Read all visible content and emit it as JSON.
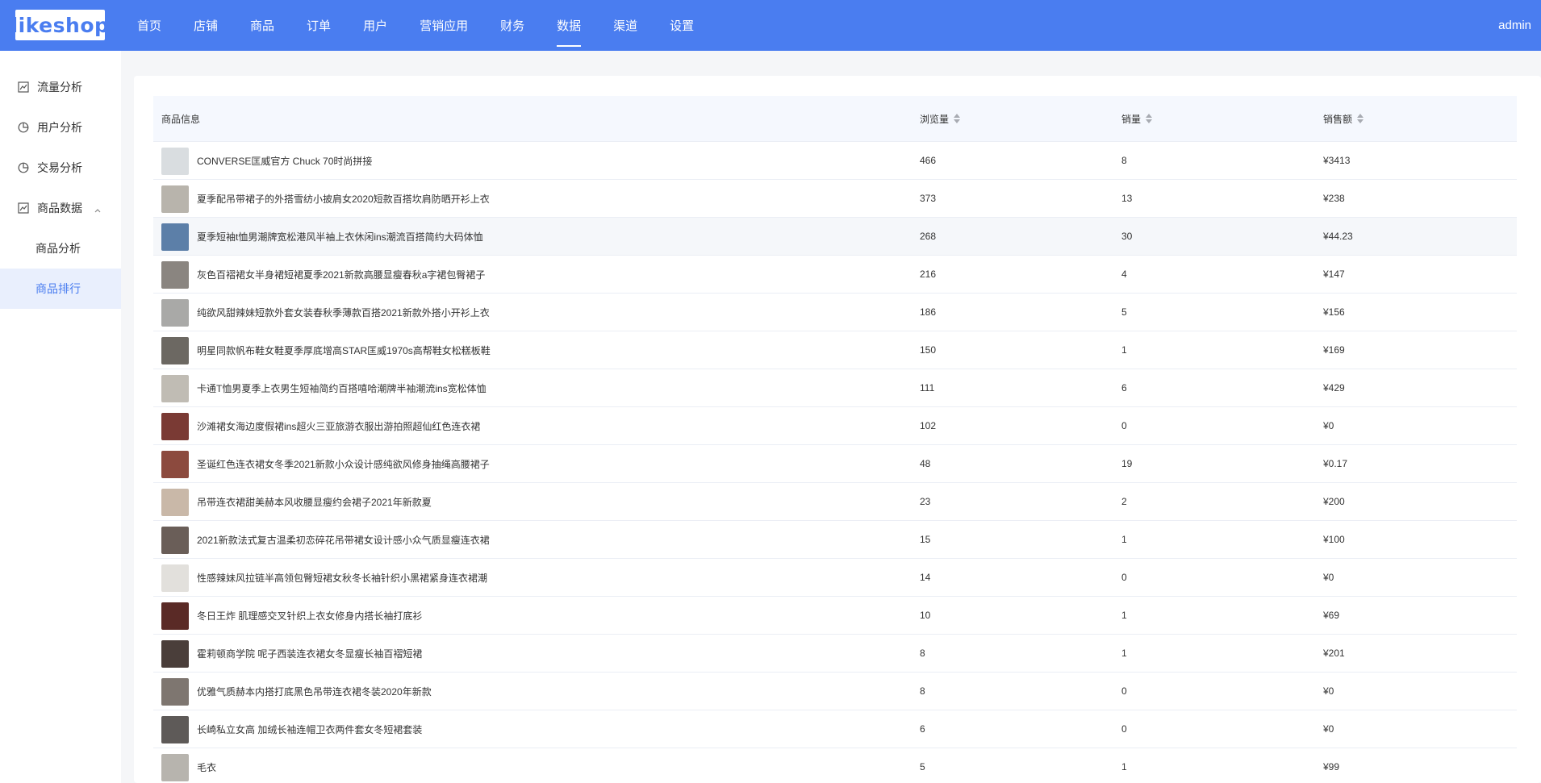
{
  "brand": {
    "logo_text": "likeshop"
  },
  "nav": {
    "items": [
      {
        "label": "首页"
      },
      {
        "label": "店铺"
      },
      {
        "label": "商品"
      },
      {
        "label": "订单"
      },
      {
        "label": "用户"
      },
      {
        "label": "营销应用"
      },
      {
        "label": "财务"
      },
      {
        "label": "数据",
        "active": true
      },
      {
        "label": "渠道"
      },
      {
        "label": "设置"
      }
    ],
    "user": "admin"
  },
  "sidebar": {
    "items": [
      {
        "label": "流量分析",
        "icon": "line-chart-icon"
      },
      {
        "label": "用户分析",
        "icon": "pie-chart-icon"
      },
      {
        "label": "交易分析",
        "icon": "pie-chart-icon"
      },
      {
        "label": "商品数据",
        "icon": "line-chart-icon"
      }
    ],
    "sub_items": [
      {
        "label": "商品分析"
      },
      {
        "label": "商品排行",
        "active": true
      }
    ]
  },
  "table": {
    "columns": {
      "info": "商品信息",
      "views": "浏览量",
      "sales": "销量",
      "amount": "销售额"
    },
    "rows": [
      {
        "name": "CONVERSE匡威官方 Chuck 70时尚拼接",
        "views": "466",
        "sales": "8",
        "amount": "¥3413",
        "thumb": "#d9dde0"
      },
      {
        "name": "夏季配吊带裙子的外搭雪纺小披肩女2020短款百搭坎肩防晒开衫上衣",
        "views": "373",
        "sales": "13",
        "amount": "¥238",
        "thumb": "#b8b4ac"
      },
      {
        "name": "夏季短袖t恤男潮牌宽松港风半袖上衣休闲ins潮流百搭简约大码体恤",
        "views": "268",
        "sales": "30",
        "amount": "¥44.23",
        "thumb": "#5c7fa8"
      },
      {
        "name": "灰色百褶裙女半身裙短裙夏季2021新款高腰显瘦春秋a字裙包臀裙子",
        "views": "216",
        "sales": "4",
        "amount": "¥147",
        "thumb": "#8a8580"
      },
      {
        "name": "纯欲风甜辣妹短款外套女装春秋季薄款百搭2021新款外搭小开衫上衣",
        "views": "186",
        "sales": "5",
        "amount": "¥156",
        "thumb": "#a9a9a7"
      },
      {
        "name": "明星同款帆布鞋女鞋夏季厚底增高STAR匡威1970s高帮鞋女松糕板鞋",
        "views": "150",
        "sales": "1",
        "amount": "¥169",
        "thumb": "#6c6862"
      },
      {
        "name": "卡通T恤男夏季上衣男生短袖简约百搭嘻哈潮牌半袖潮流ins宽松体恤",
        "views": "111",
        "sales": "6",
        "amount": "¥429",
        "thumb": "#c0bcb4"
      },
      {
        "name": "沙滩裙女海边度假裙ins超火三亚旅游衣服出游拍照超仙红色连衣裙",
        "views": "102",
        "sales": "0",
        "amount": "¥0",
        "thumb": "#7a3a34"
      },
      {
        "name": "圣诞红色连衣裙女冬季2021新款小众设计感纯欲风修身抽绳高腰裙子",
        "views": "48",
        "sales": "19",
        "amount": "¥0.17",
        "thumb": "#8c4a3e"
      },
      {
        "name": "吊带连衣裙甜美赫本风收腰显瘦约会裙子2021年新款夏",
        "views": "23",
        "sales": "2",
        "amount": "¥200",
        "thumb": "#c9b8a8"
      },
      {
        "name": "2021新款法式复古温柔初恋碎花吊带裙女设计感小众气质显瘦连衣裙",
        "views": "15",
        "sales": "1",
        "amount": "¥100",
        "thumb": "#6a5e58"
      },
      {
        "name": "性感辣妹风拉链半高领包臀短裙女秋冬长袖针织小黑裙紧身连衣裙潮",
        "views": "14",
        "sales": "0",
        "amount": "¥0",
        "thumb": "#e2e0dc"
      },
      {
        "name": "冬日王炸 肌理感交叉针织上衣女修身内搭长袖打底衫",
        "views": "10",
        "sales": "1",
        "amount": "¥69",
        "thumb": "#5a2a26"
      },
      {
        "name": "霍莉顿商学院 呢子西装连衣裙女冬显瘦长袖百褶短裙",
        "views": "8",
        "sales": "1",
        "amount": "¥201",
        "thumb": "#4a3e3a"
      },
      {
        "name": "优雅气质赫本内搭打底黑色吊带连衣裙冬装2020年新款",
        "views": "8",
        "sales": "0",
        "amount": "¥0",
        "thumb": "#7e7670"
      },
      {
        "name": "长崎私立女高 加绒长袖连帽卫衣两件套女冬短裙套装",
        "views": "6",
        "sales": "0",
        "amount": "¥0",
        "thumb": "#5e5a58"
      },
      {
        "name": "毛衣",
        "views": "5",
        "sales": "1",
        "amount": "¥99",
        "thumb": "#b7b4ae"
      }
    ]
  }
}
